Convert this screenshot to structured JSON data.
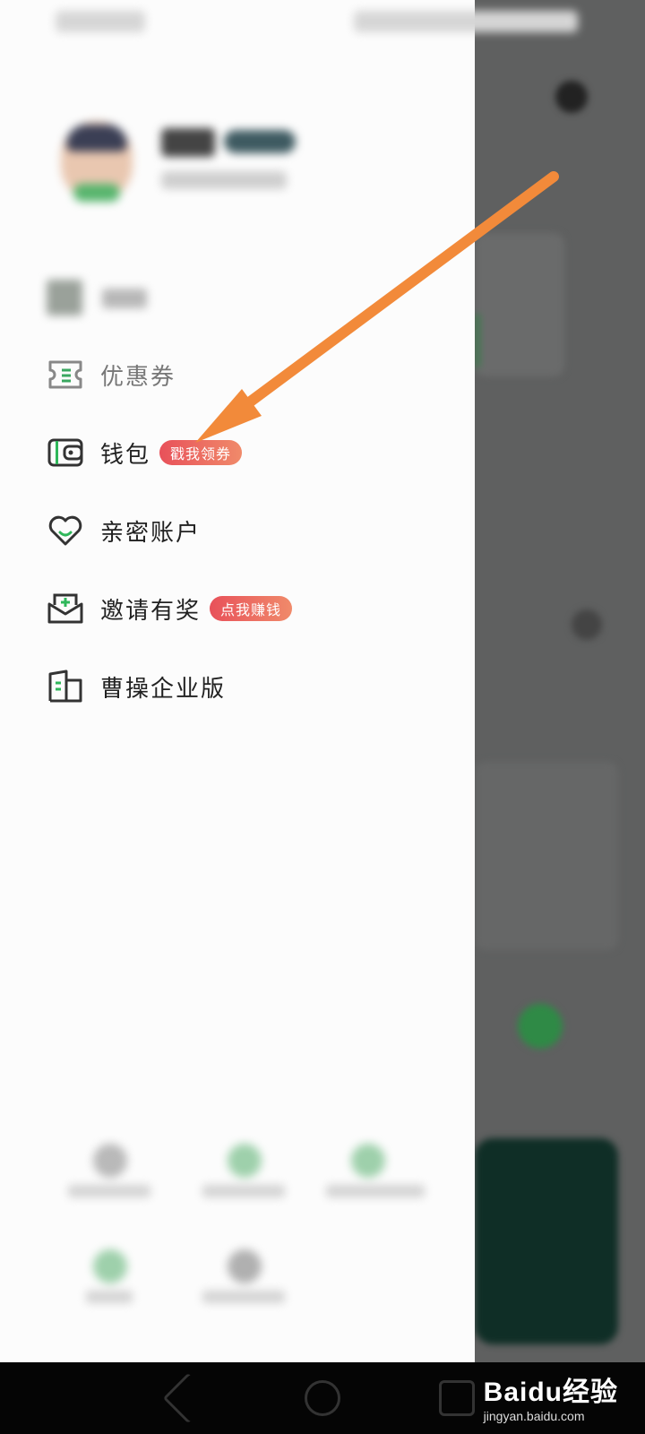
{
  "menu": {
    "items": [
      {
        "label": "优惠券",
        "tag": ""
      },
      {
        "label": "钱包",
        "tag": "戳我领券"
      },
      {
        "label": "亲密账户",
        "tag": ""
      },
      {
        "label": "邀请有奖",
        "tag": "点我赚钱"
      },
      {
        "label": "曹操企业版",
        "tag": ""
      }
    ]
  },
  "watermark": {
    "brand": "Baidu经验",
    "url": "jingyan.baidu.com"
  },
  "colors": {
    "accent_green": "#2fb75a",
    "tag_red": "#e8515a",
    "annotation_arrow": "#f28a3a"
  }
}
